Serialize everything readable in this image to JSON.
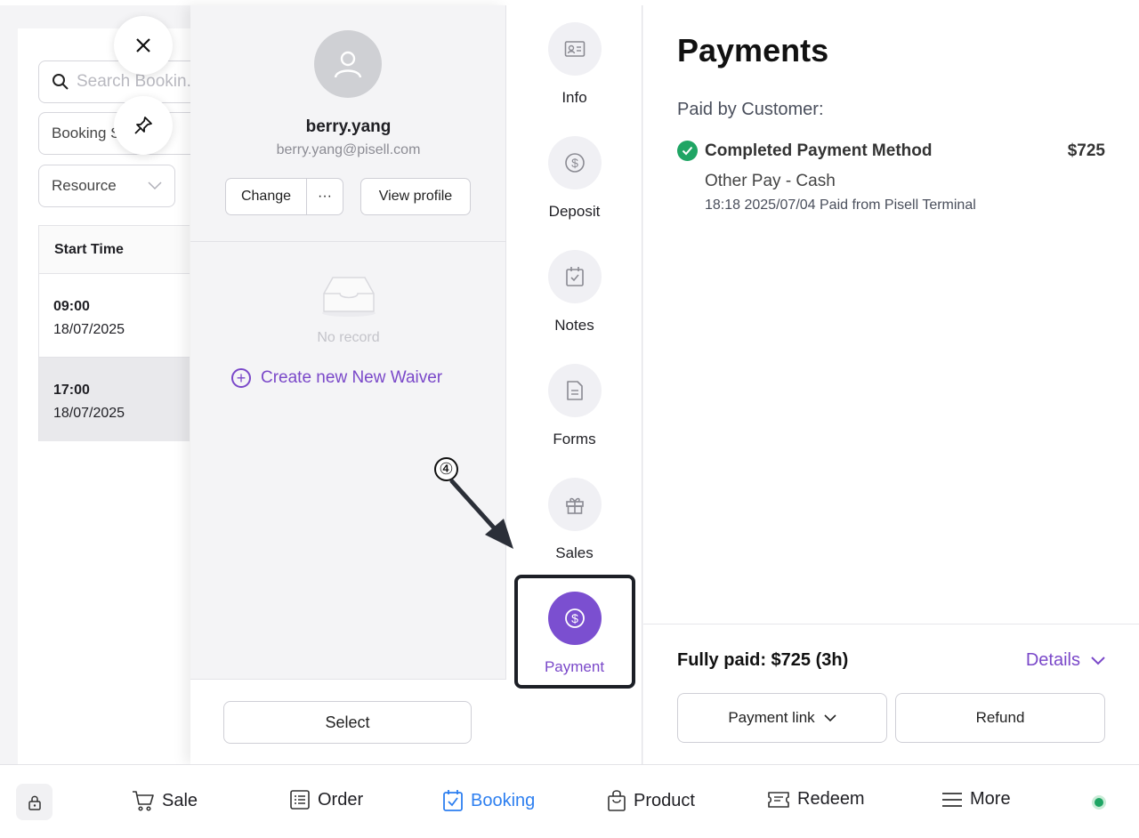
{
  "background": {
    "search_placeholder": "Search Bookin...",
    "booking_status_filter": "Booking S",
    "resource_filter": "Resource",
    "table": {
      "header": "Start Time",
      "rows": [
        {
          "time": "09:00",
          "date": "18/07/2025"
        },
        {
          "time": "17:00",
          "date": "18/07/2025"
        }
      ]
    }
  },
  "customer": {
    "name": "berry.yang",
    "email": "berry.yang@pisell.com",
    "change_label": "Change",
    "more_label": "···",
    "view_profile_label": "View profile",
    "no_record": "No record",
    "create_waiver_label": "Create new New Waiver",
    "select_label": "Select"
  },
  "sidenav": [
    {
      "label": "Info",
      "icon": "id-card-icon"
    },
    {
      "label": "Deposit",
      "icon": "dollar-icon"
    },
    {
      "label": "Notes",
      "icon": "calendar-check-icon"
    },
    {
      "label": "Forms",
      "icon": "document-icon"
    },
    {
      "label": "Sales",
      "icon": "gift-icon"
    },
    {
      "label": "Payment",
      "icon": "dollar-circle-icon",
      "active": true
    }
  ],
  "payments": {
    "title": "Payments",
    "paid_by": "Paid by Customer:",
    "method_title": "Completed Payment Method",
    "amount": "$725",
    "method": "Other Pay - Cash",
    "detail": "18:18 2025/07/04 Paid from Pisell Terminal",
    "summary": "Fully paid: $725 (3h)",
    "details_label": "Details",
    "payment_link_label": "Payment link",
    "refund_label": "Refund"
  },
  "annotation": {
    "step": "④"
  },
  "bottombar": {
    "tabs": [
      {
        "label": "Sale",
        "icon": "cart-icon"
      },
      {
        "label": "Order",
        "icon": "list-icon"
      },
      {
        "label": "Booking",
        "icon": "calendar-check-icon",
        "active": true
      },
      {
        "label": "Product",
        "icon": "bag-icon"
      },
      {
        "label": "Redeem",
        "icon": "ticket-icon"
      },
      {
        "label": "More",
        "icon": "menu-icon"
      }
    ]
  },
  "colors": {
    "accent": "#7b4fd0",
    "active_tab": "#2d7ff0",
    "success": "#1fa564"
  }
}
